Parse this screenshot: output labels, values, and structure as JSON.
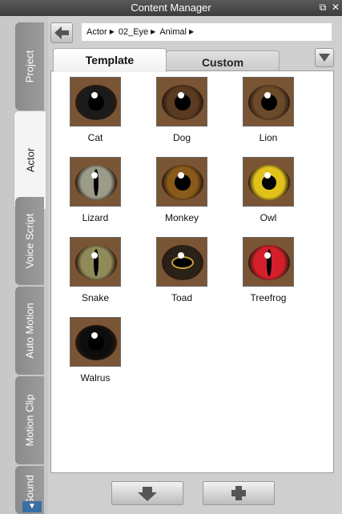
{
  "window": {
    "title": "Content Manager"
  },
  "side_tabs": [
    "Project",
    "Actor",
    "Voice Script",
    "Auto Motion",
    "Motion Clip",
    "Sound"
  ],
  "breadcrumb": [
    "Actor",
    "02_Eye",
    "Animal"
  ],
  "tabs": {
    "template": "Template",
    "custom": "Custom"
  },
  "items": [
    {
      "name": "Cat",
      "iris": "#1a1a1a"
    },
    {
      "name": "Dog",
      "iris": "#5a3a20"
    },
    {
      "name": "Lion",
      "iris": "#6b4a2a"
    },
    {
      "name": "Lizard",
      "iris": "#9b9b8a"
    },
    {
      "name": "Monkey",
      "iris": "#8a5a1a"
    },
    {
      "name": "Owl",
      "iris": "#e1c21b"
    },
    {
      "name": "Snake",
      "iris": "#8f8a5a"
    },
    {
      "name": "Toad",
      "iris": "#2a2218"
    },
    {
      "name": "Treefrog",
      "iris": "#d41f2a"
    },
    {
      "name": "Walrus",
      "iris": "#0d0d0d"
    }
  ],
  "colors": {
    "titlebar": "#454545",
    "side_tab": "#8f8f8f",
    "accent_blue": "#3a6ea5"
  },
  "icons": {
    "back": "arrow-left-icon",
    "dropdown": "triangle-down-icon",
    "download": "arrow-down-icon",
    "add": "plus-icon"
  }
}
